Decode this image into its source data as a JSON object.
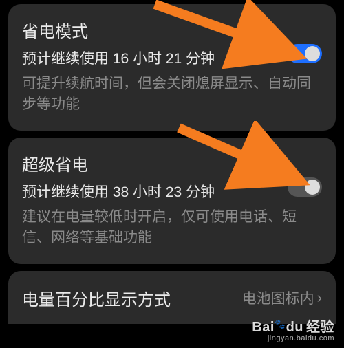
{
  "settings": [
    {
      "title": "省电模式",
      "subtitle": "预计继续使用 16 小时 21 分钟",
      "desc": "可提升续航时间，但会关闭熄屏显示、自动同步等功能",
      "toggle_on": true
    },
    {
      "title": "超级省电",
      "subtitle": "预计继续使用 38 小时 23 分钟",
      "desc": "建议在电量较低时开启，仅可使用电话、短信、网络等基础功能",
      "toggle_on": false
    }
  ],
  "row": {
    "title": "电量百分比显示方式",
    "value": "电池图标内"
  },
  "watermark": {
    "brand": "Bai",
    "brand2": "du",
    "suffix": "经验",
    "url": "jingyan.baidu.com"
  },
  "arrow_color": "#f57c1f"
}
